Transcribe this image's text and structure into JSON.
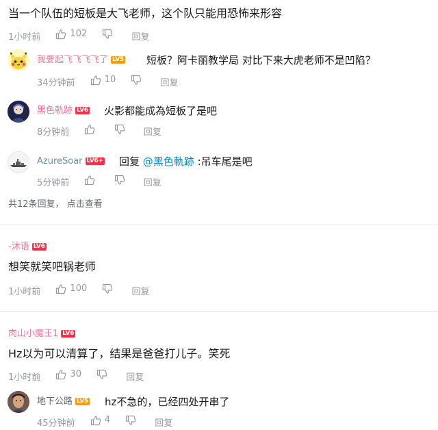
{
  "comment1": {
    "text": "当一个队伍的短板是大飞老师，这个队只能用恐怖来形容",
    "time": "1小时前",
    "likes": "102",
    "reply_label": "回复",
    "replies": [
      {
        "username": "我要起飞飞飞飞了",
        "level": "LV5",
        "text": "短板？阿卡丽教学局 对比下来大虎老师不是凹陷？",
        "time": "34分钟前",
        "likes": "10",
        "reply_label": "回复"
      },
      {
        "username": "黑色軌跡",
        "level": "LV6",
        "text": "火影都能成為短板了是吧",
        "time": "8分钟前",
        "likes": "",
        "reply_label": "回复"
      },
      {
        "username": "AzureSoar",
        "level": "LV6+",
        "reply_prefix": "回复",
        "mention": "@黑色軌跡",
        "text": ":吊车尾是吧",
        "time": "5分钟前",
        "likes": "",
        "reply_label": "回复"
      }
    ],
    "more_replies": "共12条回复，",
    "view_more": "点击查看"
  },
  "comment2": {
    "username": "-沐语",
    "level": "LV6",
    "text": "想笑就笑吧锅老师",
    "time": "1小时前",
    "likes": "100",
    "reply_label": "回复"
  },
  "comment3": {
    "username": "肉山小魔王1",
    "level": "LV6",
    "text": "Hz以为可以清算了，结果是爸爸打儿子。笑死",
    "time": "1小时前",
    "likes": "30",
    "reply_label": "回复",
    "replies": [
      {
        "username": "地下公路",
        "level": "LV5",
        "text": "hz不急的，已经四处开串了",
        "time": "45分钟前",
        "likes": "4",
        "reply_label": "回复"
      }
    ]
  },
  "icons": {
    "like": "thumb-up-icon",
    "dislike": "thumb-down-icon"
  },
  "colors": {
    "username_pink": "#fb7299",
    "meta_grey": "#9499a0",
    "mention_blue": "#008ac5",
    "level5": "#ff9b00",
    "level6": "#ff2f47"
  }
}
